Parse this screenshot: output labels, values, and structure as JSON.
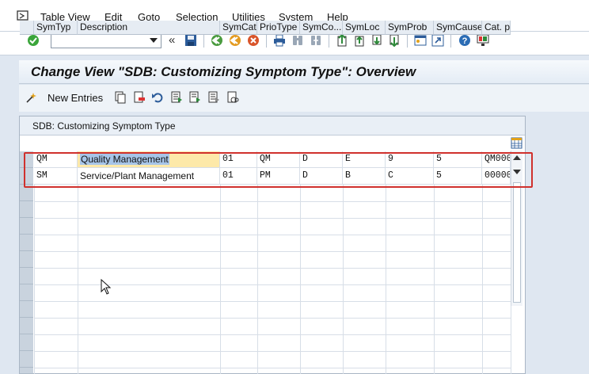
{
  "menu": {
    "items": [
      "Table View",
      "Edit",
      "Goto",
      "Selection",
      "Utilities",
      "System",
      "Help"
    ]
  },
  "toolbar": {
    "command_value": "",
    "icons": [
      "enter-icon",
      "back-icon",
      "exit-icon",
      "cancel-icon",
      "save-icon",
      "print-icon",
      "find-icon",
      "find-next-icon",
      "first-page-icon",
      "prev-page-icon",
      "next-page-icon",
      "last-page-icon",
      "create-session-icon",
      "shortcut-icon",
      "help-icon",
      "customize-layout-icon"
    ],
    "collapse_symbol": "«"
  },
  "title": "Change View \"SDB: Customizing Symptom Type\": Overview",
  "app_toolbar": {
    "new_entries_label": "New Entries"
  },
  "table": {
    "title": "SDB: Customizing Symptom Type",
    "columns": [
      "SymTyp",
      "Description",
      "SymCat",
      "PrioType",
      "SymCo...",
      "SymLoc",
      "SymProb",
      "SymCause",
      "Cat. p"
    ],
    "rows": [
      [
        "QM",
        "Quality Management",
        "01",
        "QM",
        "D",
        "E",
        "9",
        "5",
        "QM000"
      ],
      [
        "SM",
        "Service/Plant Management",
        "01",
        "PM",
        "D",
        "B",
        "C",
        "5",
        "00000"
      ]
    ]
  },
  "colors": {
    "highlight_border": "#d0312d",
    "focus_cell": "#fde9a9",
    "selection": "#a7c5e8"
  }
}
